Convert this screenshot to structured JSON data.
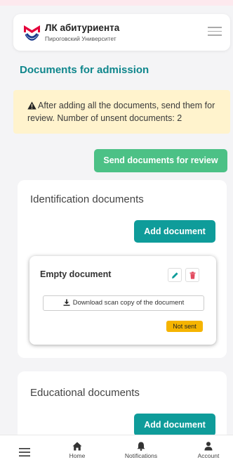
{
  "header": {
    "title": "ЛК абитуриента",
    "subtitle": "Пироговский Университет"
  },
  "page": {
    "title": "Documents for admission"
  },
  "alert": {
    "text": "After adding all the documents, send them for review. Number of unsent documents: 2"
  },
  "actions": {
    "send_label": "Send documents for review"
  },
  "sections": [
    {
      "title": "Identification documents",
      "add_label": "Add document",
      "documents": [
        {
          "title": "Empty document",
          "download_label": "Download scan copy of the document",
          "status": "Not sent"
        }
      ]
    },
    {
      "title": "Educational documents",
      "add_label": "Add document"
    }
  ],
  "bottom_nav": {
    "items": [
      {
        "label": "",
        "icon": "menu-icon"
      },
      {
        "label": "Home",
        "icon": "home-icon"
      },
      {
        "label": "Notifications",
        "icon": "bell-icon"
      },
      {
        "label": "Account",
        "icon": "user-icon"
      }
    ]
  },
  "colors": {
    "accent": "#0f868c",
    "button_teal": "#0f9c9a",
    "button_green": "#4cc186",
    "alert_bg": "#fff3cd",
    "status_badge": "#f5b400",
    "brand_red": "#e4003a",
    "brand_blue": "#1b3a8c"
  }
}
